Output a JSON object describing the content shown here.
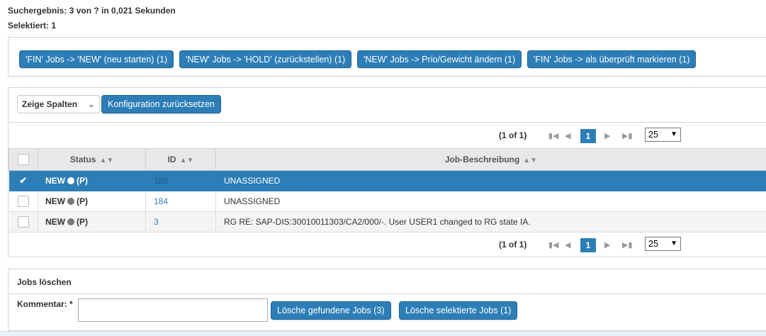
{
  "summary": {
    "search_result": "Suchergebnis: 3 von ? in 0,021 Sekunden",
    "selected": "Selektiert: 1"
  },
  "actions": [
    "'FIN' Jobs -> 'NEW' (neu starten) (1)",
    "'NEW' Jobs -> 'HOLD' (zurückstellen) (1)",
    "'NEW' Jobs -> Prio/Gewicht ändern (1)",
    "'FIN' Jobs -> als überprüft markieren (1)"
  ],
  "toolbar": {
    "columns_select": "Zeige Spalten",
    "reset_config": "Konfiguration zurücksetzen"
  },
  "paginator": {
    "info": "(1 of 1)",
    "current_page": "1",
    "rows_per_page": "25"
  },
  "table": {
    "headers": {
      "status": "Status",
      "id": "ID",
      "description": "Job-Beschreibung"
    },
    "rows": [
      {
        "selected": true,
        "status": "NEW",
        "flag": "(P)",
        "id": "185",
        "description": "UNASSIGNED"
      },
      {
        "selected": false,
        "status": "NEW",
        "flag": "(P)",
        "id": "184",
        "description": "UNASSIGNED"
      },
      {
        "selected": false,
        "status": "NEW",
        "flag": "(P)",
        "id": "3",
        "description": "RG RE: SAP-DIS:30010011303/CA2/000/-. User USER1 changed to RG state IA."
      }
    ]
  },
  "delete_panel": {
    "title": "Jobs löschen",
    "comment_label": "Kommentar: *",
    "comment_value": "",
    "delete_found": "Lösche gefundene Jobs (3)",
    "delete_selected": "Lösche selektierte Jobs (1)"
  },
  "colors": {
    "accent": "#2d7eb6",
    "header_bg": "#e8e8e8"
  },
  "icons": [
    "chevron-down-icon",
    "first-page-icon",
    "prev-page-icon",
    "next-page-icon",
    "last-page-icon",
    "sort-icon",
    "checkmark-icon",
    "status-dot-icon"
  ]
}
